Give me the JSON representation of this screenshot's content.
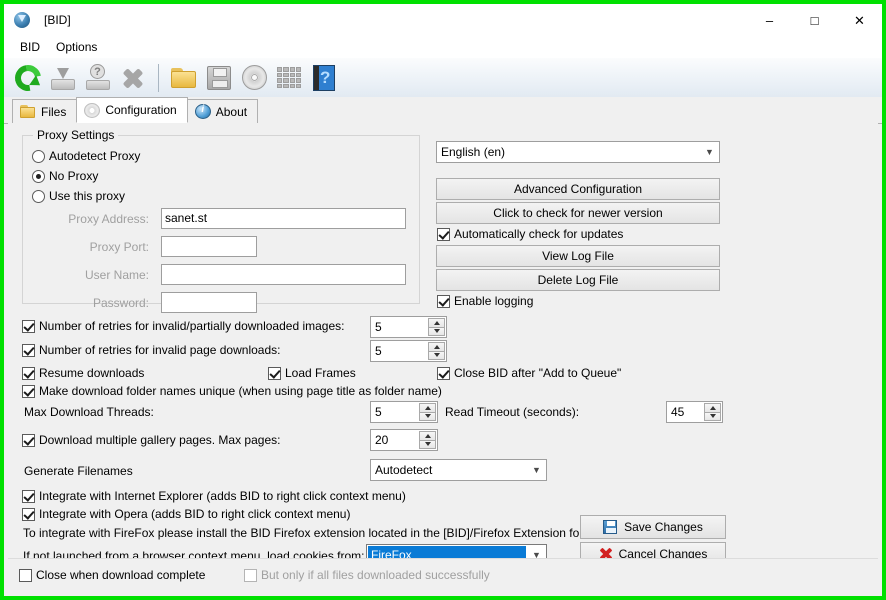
{
  "window": {
    "title": "[BID]",
    "icon": "bid-download-icon",
    "minimize": "–",
    "maximize": "□",
    "close": "✕",
    "border_color": "#00e000"
  },
  "menubar": {
    "items": [
      {
        "label": "BID",
        "name": "menu-bid"
      },
      {
        "label": "Options",
        "name": "menu-options"
      }
    ]
  },
  "toolbar": {
    "buttons": [
      {
        "name": "refresh-icon",
        "tooltip": "Refresh",
        "enabled": true
      },
      {
        "name": "download-icon",
        "tooltip": "Download",
        "enabled": false
      },
      {
        "name": "help-tray-icon",
        "tooltip": "Help",
        "enabled": false
      },
      {
        "name": "cancel-x-icon",
        "tooltip": "Cancel",
        "enabled": false
      },
      {
        "name": "folder-icon",
        "tooltip": "Open folder",
        "enabled": true
      },
      {
        "name": "save-floppy-icon",
        "tooltip": "Save",
        "enabled": true
      },
      {
        "name": "gear-disc-icon",
        "tooltip": "Settings",
        "enabled": true
      },
      {
        "name": "grid-icon",
        "tooltip": "Grid view",
        "enabled": true
      },
      {
        "name": "help-book-icon",
        "tooltip": "Help book",
        "enabled": true
      }
    ]
  },
  "tabs": [
    {
      "label": "Files",
      "icon": "folder-icon",
      "active": false
    },
    {
      "label": "Configuration",
      "icon": "gear-icon",
      "active": true
    },
    {
      "label": "About",
      "icon": "info-icon",
      "active": false
    }
  ],
  "proxy": {
    "legend": "Proxy Settings",
    "options": [
      {
        "label": "Autodetect Proxy",
        "selected": false
      },
      {
        "label": "No Proxy",
        "selected": true
      },
      {
        "label": "Use this proxy",
        "selected": false
      }
    ],
    "fields": [
      {
        "label": "Proxy Address:",
        "value": "sanet.st",
        "disabled": true
      },
      {
        "label": "Proxy Port:",
        "value": "",
        "disabled": true
      },
      {
        "label": "User Name:",
        "value": "",
        "disabled": true
      },
      {
        "label": "Password:",
        "value": "",
        "disabled": true
      }
    ]
  },
  "right_panel": {
    "language": "English (en)",
    "advanced_configuration": "Advanced Configuration",
    "check_newer_version": "Click to check for newer version",
    "auto_check_updates": {
      "label": "Automatically check for updates",
      "checked": true
    },
    "view_log": "View Log File",
    "delete_log": "Delete Log File",
    "enable_logging": {
      "label": "Enable logging",
      "checked": true
    }
  },
  "options": {
    "retries_images": {
      "label": "Number of retries for invalid/partially downloaded images:",
      "checked": true,
      "value": "5"
    },
    "retries_pages": {
      "label": "Number of retries for invalid page downloads:",
      "checked": true,
      "value": "5"
    },
    "resume_downloads": {
      "label": "Resume downloads",
      "checked": true
    },
    "load_frames": {
      "label": "Load Frames",
      "checked": true
    },
    "close_after_queue": {
      "label": "Close BID after \"Add to Queue\"",
      "checked": true
    },
    "unique_folder_names": {
      "label": "Make download folder names unique (when using page title as folder name)",
      "checked": true
    },
    "max_threads": {
      "label": "Max Download Threads:",
      "value": "5"
    },
    "read_timeout": {
      "label": "Read Timeout (seconds):",
      "value": "45"
    },
    "multiple_gallery": {
      "label": "Download multiple gallery pages. Max pages:",
      "checked": true,
      "value": "20"
    },
    "generate_filenames": {
      "label": "Generate Filenames",
      "value": "Autodetect"
    },
    "integrate_ie": {
      "label": "Integrate with Internet Explorer (adds BID to right click context menu)",
      "checked": true
    },
    "integrate_opera": {
      "label": "Integrate with Opera (adds BID to right click context menu)",
      "checked": true
    },
    "firefox_note": "To integrate with FireFox please install the BID Firefox extension located in the [BID]/Firefox Extension folder.",
    "cookies_label": "If not launched from a browser context menu, load cookies from:",
    "cookies_value": "FireFox"
  },
  "actions": {
    "save": "Save Changes",
    "cancel": "Cancel Changes"
  },
  "status_bar": {
    "close_when_complete": {
      "label": "Close when download complete",
      "checked": false
    },
    "only_if_success": {
      "label": "But only if all files downloaded successfully",
      "checked": false,
      "disabled": true
    }
  },
  "colors": {
    "selection_blue": "#0a7bd6",
    "window_border": "#00e000",
    "face": "#f0f0f0"
  }
}
